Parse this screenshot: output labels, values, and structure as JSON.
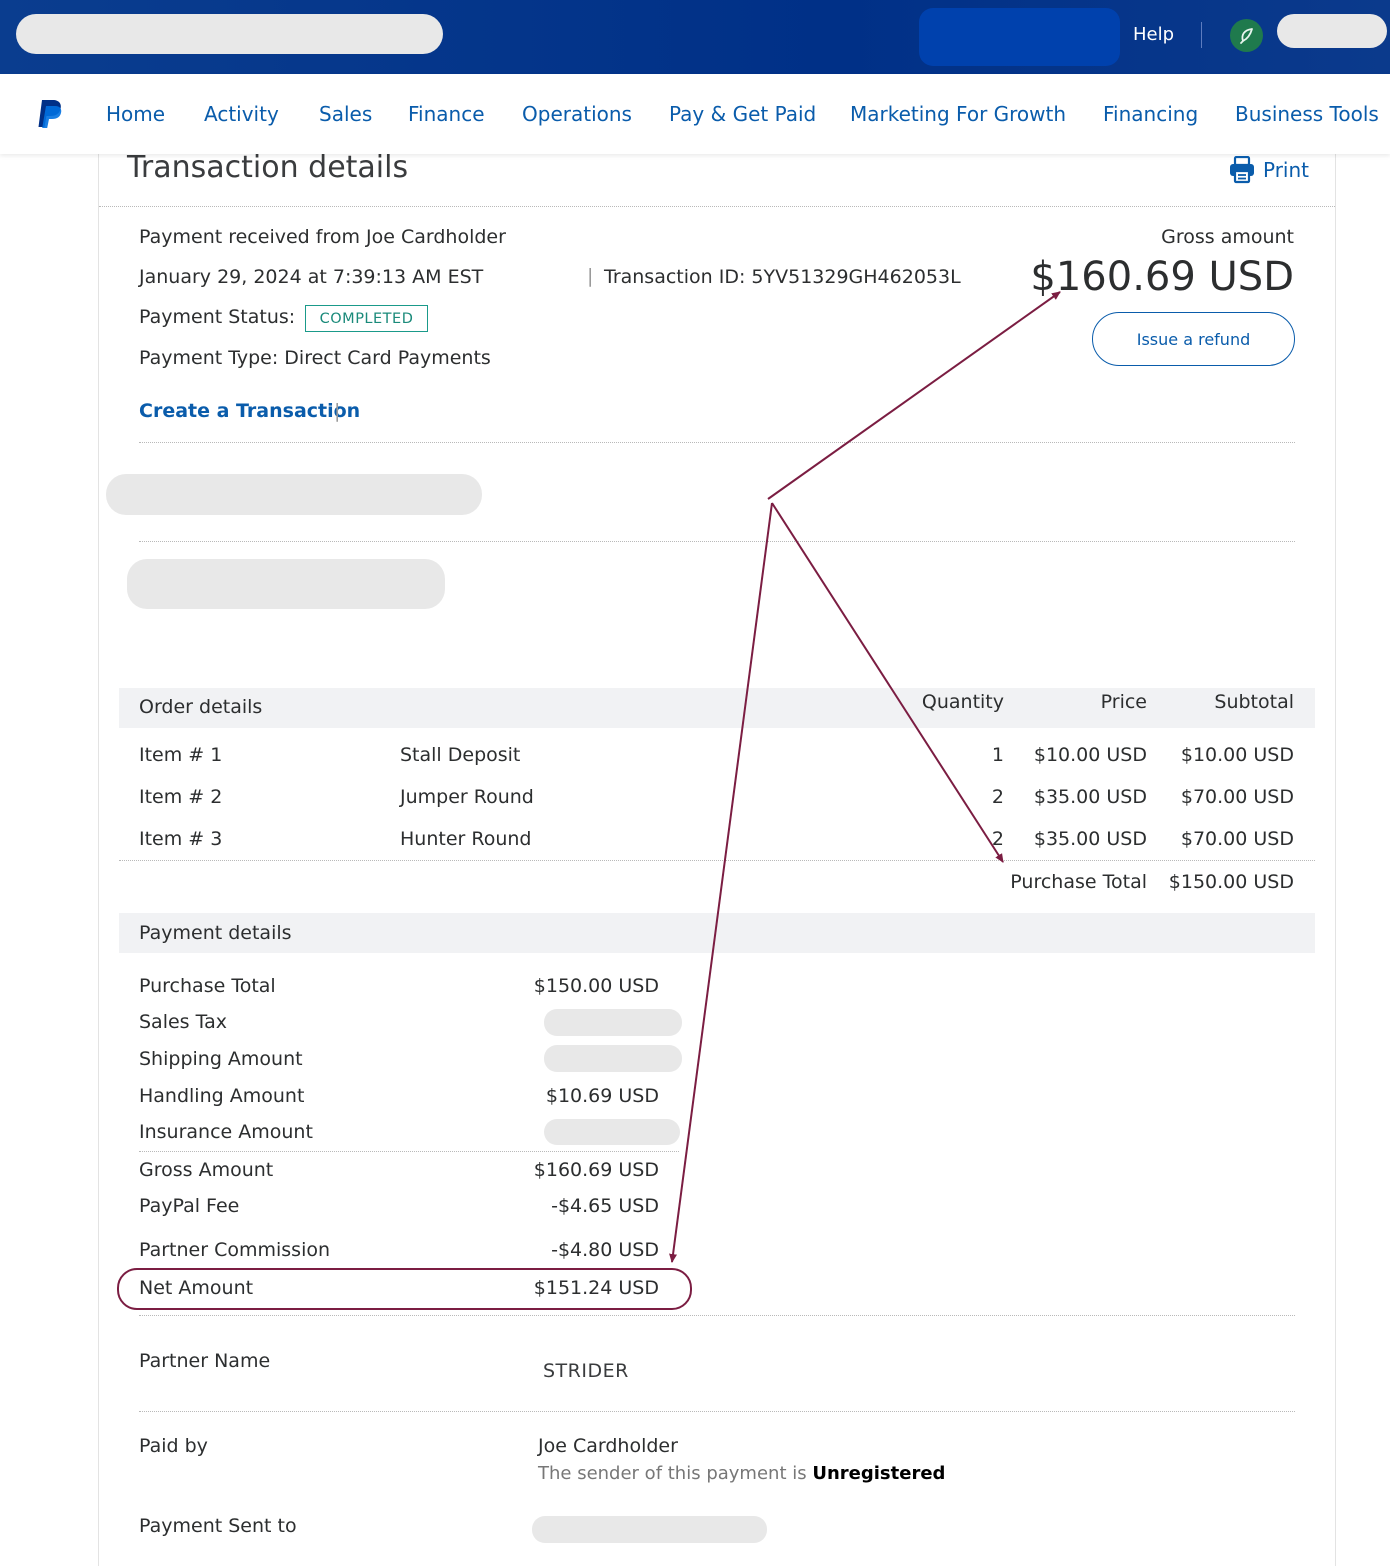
{
  "header": {
    "help_label": "Help"
  },
  "nav": {
    "items": [
      "Home",
      "Activity",
      "Sales",
      "Finance",
      "Operations",
      "Pay & Get Paid",
      "Marketing For Growth",
      "Financing",
      "Business Tools"
    ]
  },
  "page": {
    "title": "Transaction details",
    "print_label": "Print"
  },
  "summary": {
    "received_from": "Payment received from Joe Cardholder",
    "date": "January 29, 2024 at 7:39:13 AM EST",
    "transaction_id": "Transaction ID: 5YV51329GH462053L",
    "status_label": "Payment Status:",
    "status_value": "COMPLETED",
    "payment_type": "Payment Type: Direct Card Payments",
    "create_link": "Create a Transaction",
    "gross_label": "Gross amount",
    "gross_value": "$160.69 USD",
    "refund_label": "Issue a refund"
  },
  "order": {
    "heading": "Order details",
    "col_quantity": "Quantity",
    "col_price": "Price",
    "col_subtotal": "Subtotal",
    "rows": [
      {
        "item": "Item # 1",
        "name": "Stall Deposit",
        "qty": "1",
        "price": "$10.00 USD",
        "subtotal": "$10.00 USD"
      },
      {
        "item": "Item # 2",
        "name": "Jumper Round",
        "qty": "2",
        "price": "$35.00 USD",
        "subtotal": "$70.00 USD"
      },
      {
        "item": "Item # 3",
        "name": "Hunter Round",
        "qty": "2",
        "price": "$35.00 USD",
        "subtotal": "$70.00 USD"
      }
    ],
    "total_label": "Purchase Total",
    "total_value": "$150.00 USD"
  },
  "payment": {
    "heading": "Payment details",
    "rows": [
      {
        "label": "Purchase Total",
        "value": "$150.00 USD"
      },
      {
        "label": "Sales Tax",
        "value": ""
      },
      {
        "label": "Shipping Amount",
        "value": ""
      },
      {
        "label": "Handling Amount",
        "value": "$10.69 USD"
      },
      {
        "label": "Insurance Amount",
        "value": ""
      },
      {
        "label": "Gross Amount",
        "value": "$160.69 USD"
      },
      {
        "label": "PayPal Fee",
        "value": "-$4.65 USD"
      },
      {
        "label": "Partner Commission",
        "value": "-$4.80 USD"
      },
      {
        "label": "Net Amount",
        "value": "$151.24 USD"
      }
    ]
  },
  "partner": {
    "label": "Partner Name",
    "value": "STRIDER"
  },
  "paid_by": {
    "label": "Paid by",
    "name": "Joe Cardholder",
    "note": "The sender of this payment is",
    "status": "Unregistered"
  },
  "sent_to": {
    "label": "Payment Sent to"
  },
  "colors": {
    "header_blue": "#003087",
    "link_blue": "#0a5cab",
    "annotation": "#7b1d42",
    "status_teal": "#1a9a8a"
  }
}
